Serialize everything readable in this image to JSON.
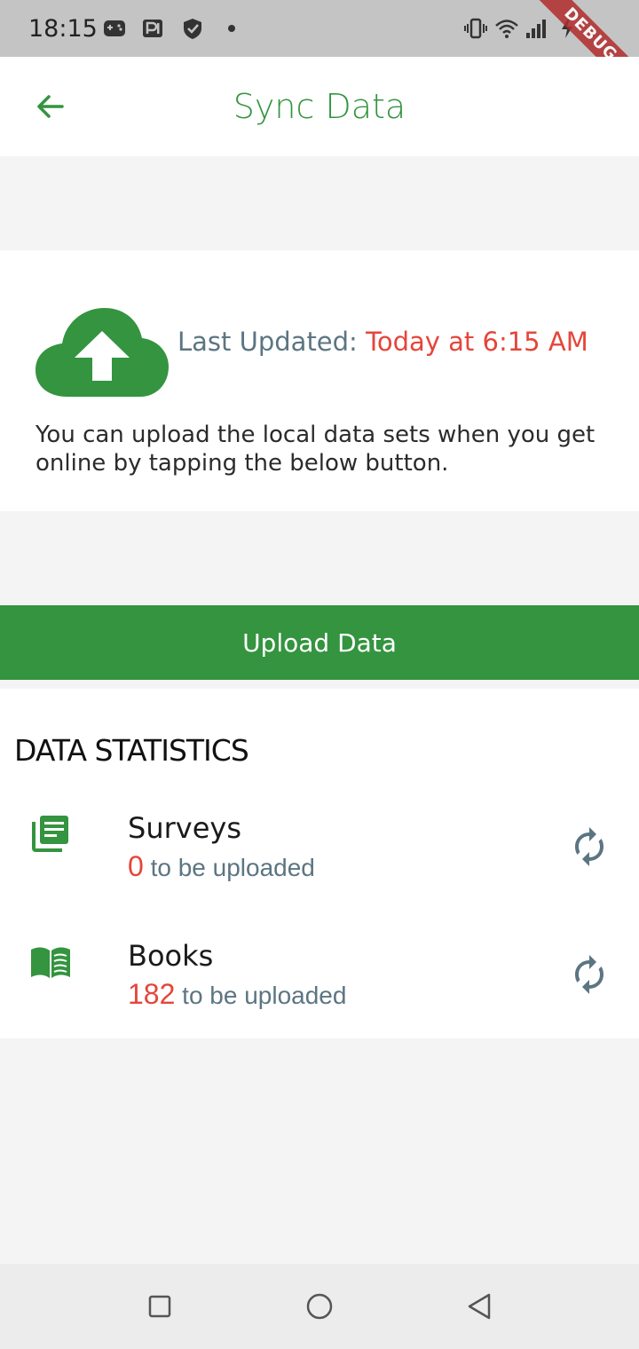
{
  "status_bar": {
    "time": "18:15",
    "debug_label": "DEBUG",
    "icons": [
      "gamepad-icon",
      "parking-icon",
      "shield-icon",
      "dot-icon",
      "vibrate-icon",
      "wifi-icon",
      "signal-icon",
      "battery-icon"
    ]
  },
  "app_bar": {
    "title": "Sync Data",
    "back_icon": "arrow-left-icon"
  },
  "info": {
    "cloud_icon": "cloud-upload-icon",
    "last_updated_label": "Last Updated: ",
    "last_updated_value": "Today at 6:15 AM",
    "description": "You can upload the local data sets when you get online by tapping the below button."
  },
  "upload_button": {
    "label": "Upload Data"
  },
  "statistics": {
    "header": "DATA STATISTICS",
    "items": [
      {
        "icon": "library-books-icon",
        "title": "Surveys",
        "count": "0",
        "suffix": " to be uploaded",
        "action_icon": "sync-icon"
      },
      {
        "icon": "menu-book-icon",
        "title": "Books",
        "count": "182",
        "suffix": " to be uploaded",
        "action_icon": "sync-icon"
      }
    ]
  },
  "nav_bar": {
    "icons": [
      "recent-apps-icon",
      "home-icon",
      "back-icon"
    ]
  },
  "colors": {
    "primary_green": "#34943f",
    "accent_red": "#e5453b",
    "muted_blue_grey": "#5c7582",
    "status_bar_bg": "#c4c4c4"
  }
}
